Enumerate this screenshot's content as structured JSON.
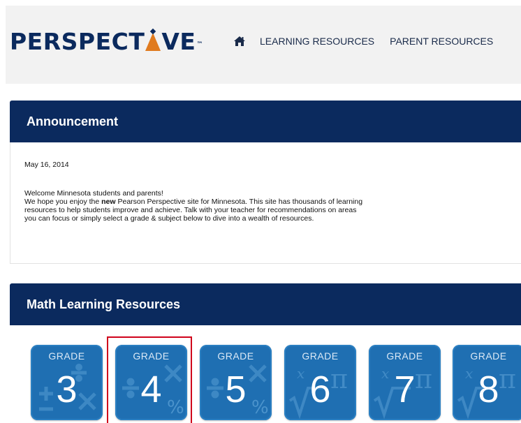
{
  "header": {
    "logo_text_before": "PERSPECT",
    "logo_text_after": "VE",
    "logo_tm": "™",
    "nav": [
      {
        "label": "LEARNING RESOURCES"
      },
      {
        "label": "PARENT RESOURCES"
      }
    ]
  },
  "announcement": {
    "title": "Announcement",
    "date": "May 16, 2014",
    "line1": "Welcome Minnesota students and parents!",
    "line2_pre": "We hope you enjoy the ",
    "line2_bold": "new",
    "line2_post": " Pearson Perspective site for Minnesota.  This site has thousands of learning",
    "line3": "resources to help students improve and achieve.  Talk with your teacher for recommendations on areas",
    "line4": "you can focus or simply select a grade & subject below to dive into a wealth of resources."
  },
  "math": {
    "title": "Math Learning Resources",
    "tiles": [
      {
        "label": "GRADE",
        "number": "3",
        "icon": "math-operators-icon"
      },
      {
        "label": "GRADE",
        "number": "4",
        "icon": "math-operators-icon",
        "selected": true
      },
      {
        "label": "GRADE",
        "number": "5",
        "icon": "math-operators-icon"
      },
      {
        "label": "GRADE",
        "number": "6",
        "icon": "math-pi-sqrt-icon"
      },
      {
        "label": "GRADE",
        "number": "7",
        "icon": "math-pi-sqrt-icon"
      },
      {
        "label": "GRADE",
        "number": "8",
        "icon": "math-pi-sqrt-icon"
      }
    ]
  },
  "colors": {
    "navy": "#0b2a5e",
    "accent_orange": "#e07b1f",
    "tile_blue": "#1f6fb2",
    "selection_red": "#d0021b"
  }
}
